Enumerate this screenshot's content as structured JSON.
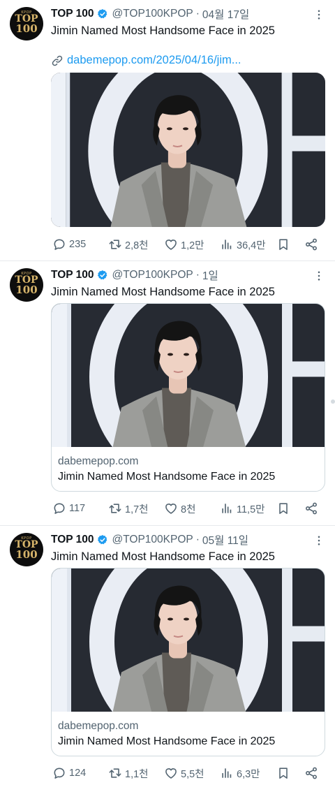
{
  "colors": {
    "accent": "#1d9bf0",
    "verified": "#1d9bf0",
    "muted": "#536471",
    "text": "#0f1419"
  },
  "tweets": [
    {
      "avatar": {
        "small": "KPOP",
        "line1": "TOP",
        "line2": "100"
      },
      "name": "TOP 100",
      "handle": "@TOP100KPOP",
      "dot": "·",
      "time": "04월 17일",
      "text": "Jimin Named Most Handsome Face in 2025",
      "link": "dabemepop.com/2025/04/16/jim...",
      "media": "photo",
      "counts": {
        "replies": "235",
        "reposts": "2,8천",
        "likes": "1,2만",
        "views": "36,4만"
      },
      "icons": [
        "reply-icon",
        "repost-icon",
        "like-icon",
        "views-icon",
        "bookmark-icon",
        "share-icon"
      ]
    },
    {
      "avatar": {
        "small": "KPOP",
        "line1": "TOP",
        "line2": "100"
      },
      "name": "TOP 100",
      "handle": "@TOP100KPOP",
      "dot": "·",
      "time": "1일",
      "text": "Jimin Named Most Handsome Face in 2025",
      "card": {
        "domain": "dabemepop.com",
        "title": "Jimin Named Most Handsome Face in 2025"
      },
      "counts": {
        "replies": "117",
        "reposts": "1,7천",
        "likes": "8천",
        "views": "11,5만"
      }
    },
    {
      "avatar": {
        "small": "KPOP",
        "line1": "TOP",
        "line2": "100"
      },
      "name": "TOP 100",
      "handle": "@TOP100KPOP",
      "dot": "·",
      "time": "05월 11일",
      "text": "Jimin Named Most Handsome Face in 2025",
      "card": {
        "domain": "dabemepop.com",
        "title": "Jimin Named Most Handsome Face in 2025"
      },
      "counts": {
        "replies": "124",
        "reposts": "1,1천",
        "likes": "5,5천",
        "views": "6,3만"
      }
    }
  ]
}
